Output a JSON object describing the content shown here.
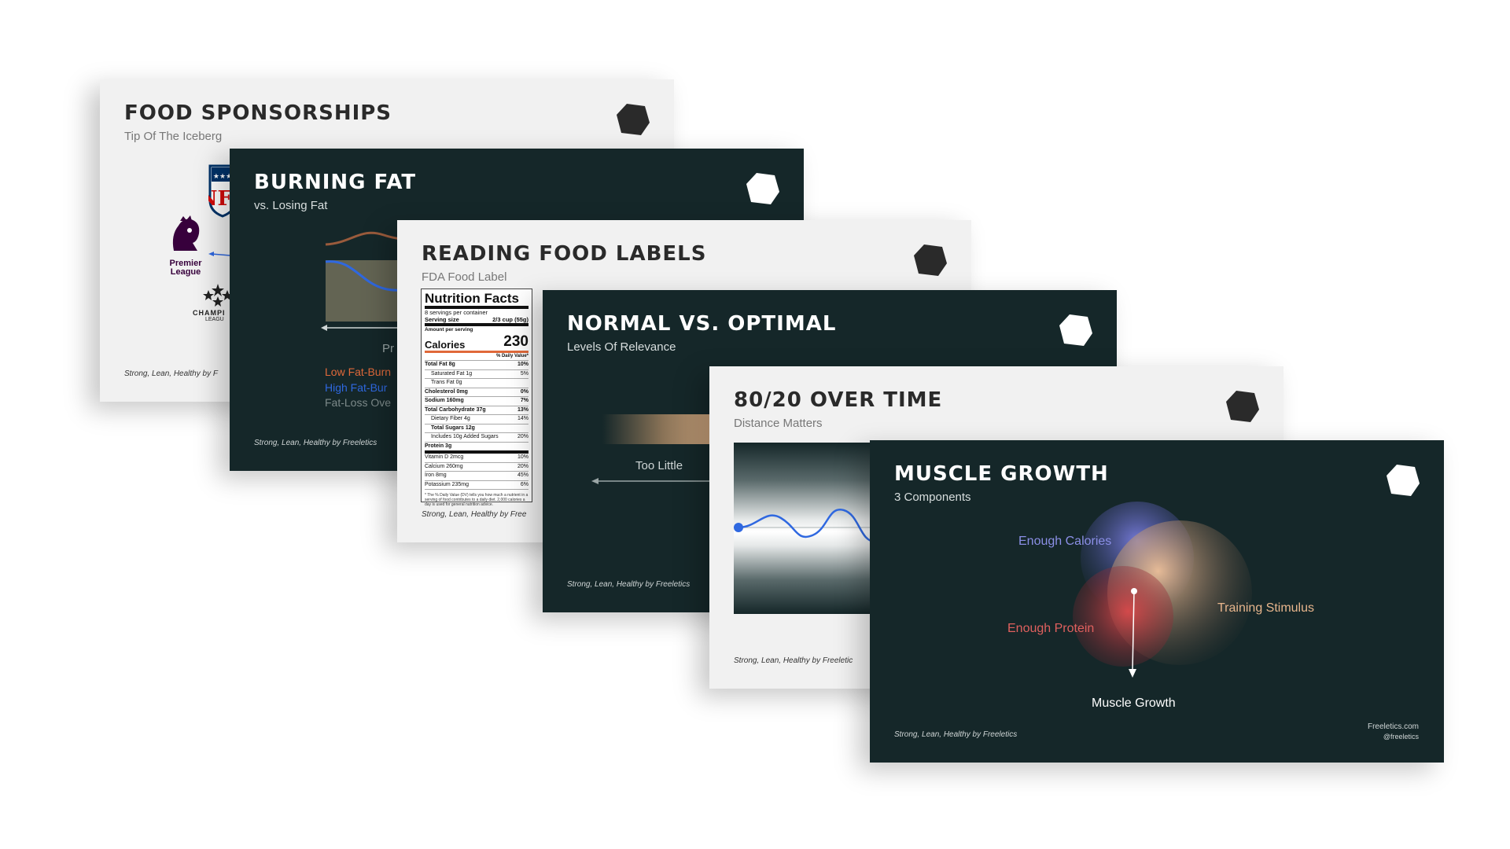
{
  "colors": {
    "dark_bg": "#152729",
    "light_bg": "#f1f1f1",
    "accent_orange": "#e0693a",
    "accent_blue": "#2f68e0",
    "venn_purple": "#6b6fd6",
    "venn_red": "#c84346",
    "venn_peach": "#e6b08b"
  },
  "common": {
    "footer": "Strong, Lean, Healthy by Freeletics",
    "logo_icon": "freeletics-hexagon-icon"
  },
  "slides": {
    "food_sponsorships": {
      "title": "FOOD SPONSORSHIPS",
      "subtitle": "Tip Of The Iceberg",
      "footer": "Strong, Lean, Healthy by F",
      "logos": {
        "nfl": "NFL",
        "premier_league": "Premier League",
        "champions_league": "CHAMPI",
        "champions_league_sub": "LEAGU"
      }
    },
    "burning_fat": {
      "title": "BURNING FAT",
      "subtitle": "vs. Losing Fat",
      "axis_label": "Pr",
      "legend": [
        "Low Fat-Burn",
        "High Fat-Bur",
        "Fat-Loss Ove"
      ]
    },
    "reading_food_labels": {
      "title": "READING FOOD LABELS",
      "subtitle": "FDA Food Label",
      "footer": "Strong, Lean, Healthy by Free",
      "nutrition": {
        "heading": "Nutrition Facts",
        "servings": "8 servings per container",
        "serving_size_label": "Serving size",
        "serving_size_value": "2/3 cup (55g)",
        "amount_per_serving": "Amount per serving",
        "calories_label": "Calories",
        "calories_value": "230",
        "daily_value": "% Daily Value*",
        "rows": [
          {
            "name": "Total Fat 8g",
            "dv": "10%"
          },
          {
            "name": "Saturated Fat 1g",
            "dv": "5%"
          },
          {
            "name": "Trans Fat 0g",
            "dv": ""
          },
          {
            "name": "Cholesterol 0mg",
            "dv": "0%"
          },
          {
            "name": "Sodium 160mg",
            "dv": "7%"
          },
          {
            "name": "Total Carbohydrate 37g",
            "dv": "13%"
          },
          {
            "name": "Dietary Fiber 4g",
            "dv": "14%"
          },
          {
            "name": "Total Sugars 12g",
            "dv": ""
          },
          {
            "name": "Includes 10g Added Sugars",
            "dv": "20%"
          },
          {
            "name": "Protein 3g",
            "dv": ""
          },
          {
            "name": "Vitamin D 2mcg",
            "dv": "10%"
          },
          {
            "name": "Calcium 260mg",
            "dv": "20%"
          },
          {
            "name": "Iron 8mg",
            "dv": "45%"
          },
          {
            "name": "Potassium 235mg",
            "dv": "6%"
          }
        ],
        "footnote": "* The % Daily Value (DV) tells you how much a nutrient in a serving of food contributes to a daily diet. 2,000 calories a day is used for general nutrition advice."
      }
    },
    "normal_vs_optimal": {
      "title": "NORMAL VS. OPTIMAL",
      "subtitle": "Levels Of Relevance",
      "arrow_label": "Too Little",
      "footer": "Strong, Lean, Healthy by Freeletics"
    },
    "over_time": {
      "title": "80/20 OVER TIME",
      "subtitle": "Distance Matters",
      "footer": "Strong, Lean, Healthy by Freeletic"
    },
    "muscle_growth": {
      "title": "MUSCLE GROWTH",
      "subtitle": "3 Components",
      "labels": {
        "calories": "Enough Calories",
        "stimulus": "Training Stimulus",
        "protein": "Enough Protein",
        "growth": "Muscle Growth"
      },
      "footer": "Strong, Lean, Healthy by Freeletics",
      "site": "Freeletics.com",
      "handle": "@freeletics"
    }
  }
}
